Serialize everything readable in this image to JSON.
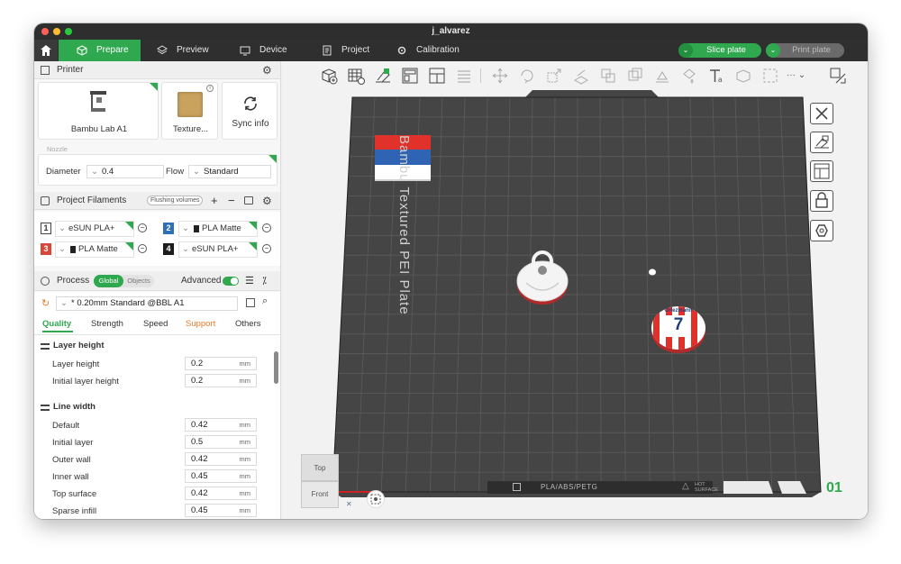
{
  "window": {
    "title": "j_alvarez"
  },
  "nav": {
    "tabs": [
      {
        "label": "Prepare",
        "active": true
      },
      {
        "label": "Preview"
      },
      {
        "label": "Device"
      },
      {
        "label": "Project"
      },
      {
        "label": "Calibration"
      }
    ],
    "slice_label": "Slice plate",
    "print_label": "Print plate"
  },
  "printer": {
    "section_title": "Printer",
    "name": "Bambu Lab A1",
    "plate": "Texture...",
    "sync_label": "Sync info",
    "nozzle_label": "Nozzle",
    "diameter_label": "Diameter",
    "diameter_value": "0.4",
    "flow_label": "Flow",
    "flow_value": "Standard"
  },
  "filaments": {
    "section_title": "Project Filaments",
    "flush_label": "Flushing volumes",
    "items": [
      {
        "num": "1",
        "name": "eSUN PLA+",
        "color": "#ffffff",
        "textcolor": "#222222"
      },
      {
        "num": "2",
        "name": "PLA Matte",
        "color": "#2f6fb5",
        "textcolor": "#ffffff"
      },
      {
        "num": "3",
        "name": "PLA Matte",
        "color": "#d9473a",
        "textcolor": "#ffffff"
      },
      {
        "num": "4",
        "name": "eSUN PLA+",
        "color": "#1c1c1c",
        "textcolor": "#ffffff"
      }
    ]
  },
  "process": {
    "section_title": "Process",
    "global_label": "Global",
    "objects_label": "Objects",
    "advanced_label": "Advanced",
    "preset": "* 0.20mm Standard @BBL A1",
    "tabs": [
      "Quality",
      "Strength",
      "Speed",
      "Support",
      "Others"
    ],
    "groups": [
      {
        "title": "Layer height",
        "rows": [
          {
            "label": "Layer height",
            "value": "0.2",
            "unit": "mm"
          },
          {
            "label": "Initial layer height",
            "value": "0.2",
            "unit": "mm"
          }
        ]
      },
      {
        "title": "Line width",
        "rows": [
          {
            "label": "Default",
            "value": "0.42",
            "unit": "mm"
          },
          {
            "label": "Initial layer",
            "value": "0.5",
            "unit": "mm"
          },
          {
            "label": "Outer wall",
            "value": "0.42",
            "unit": "mm"
          },
          {
            "label": "Inner wall",
            "value": "0.45",
            "unit": "mm"
          },
          {
            "label": "Top surface",
            "value": "0.42",
            "unit": "mm"
          },
          {
            "label": "Sparse infill",
            "value": "0.45",
            "unit": "mm"
          }
        ]
      }
    ]
  },
  "plate": {
    "bed_label": "Bambu Textured PEI Plate",
    "plate_number": "01",
    "bottom_label": "PLA/ABS/PETG",
    "hot_label": "HOT SURFACE",
    "medal_name": "Griezmann",
    "medal_number": "7"
  },
  "viewcube": {
    "top": "Top",
    "front": "Front"
  },
  "colors": {
    "accent": "#2fa84f",
    "bed": "#454545",
    "topbar": "#2f2f2f"
  }
}
